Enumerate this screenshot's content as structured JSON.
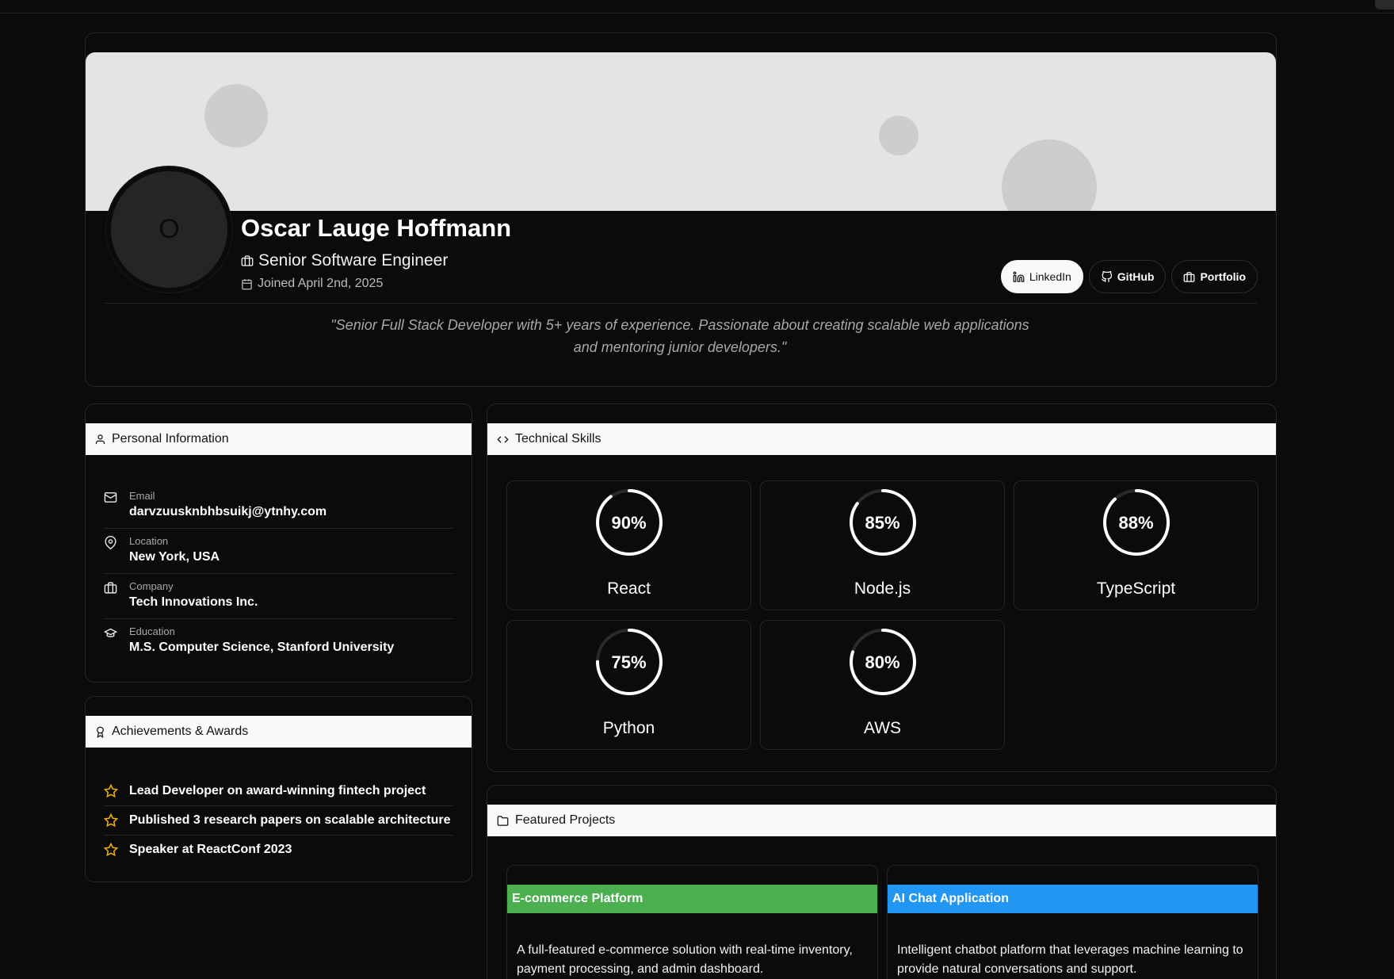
{
  "profile": {
    "avatar_initial": "O",
    "name": "Oscar Lauge Hoffmann",
    "role": "Senior Software Engineer",
    "joined": "Joined April 2nd, 2025",
    "bio": "\"Senior Full Stack Developer with 5+ years of experience. Passionate about creating scalable web applications and mentoring junior developers.\"",
    "socials": [
      {
        "label": "LinkedIn",
        "icon": "linkedin-icon"
      },
      {
        "label": "GitHub",
        "icon": "github-icon"
      },
      {
        "label": "Portfolio",
        "icon": "briefcase-icon"
      }
    ]
  },
  "personal": {
    "title": "Personal Information",
    "rows": [
      {
        "label": "Email",
        "value": "darvzuusknbhbsuikj@ytnhy.com",
        "icon": "mail-icon"
      },
      {
        "label": "Location",
        "value": "New York, USA",
        "icon": "map-pin-icon"
      },
      {
        "label": "Company",
        "value": "Tech Innovations Inc.",
        "icon": "briefcase-icon"
      },
      {
        "label": "Education",
        "value": "M.S. Computer Science, Stanford University",
        "icon": "graduation-cap-icon"
      }
    ]
  },
  "achievements": {
    "title": "Achievements & Awards",
    "items": [
      "Lead Developer on award-winning fintech project",
      "Published 3 research papers on scalable architecture",
      "Speaker at ReactConf 2023"
    ]
  },
  "skills": {
    "title": "Technical Skills",
    "items": [
      {
        "name": "React",
        "percent": 90,
        "label": "90%"
      },
      {
        "name": "Node.js",
        "percent": 85,
        "label": "85%"
      },
      {
        "name": "TypeScript",
        "percent": 88,
        "label": "88%"
      },
      {
        "name": "Python",
        "percent": 75,
        "label": "75%"
      },
      {
        "name": "AWS",
        "percent": 80,
        "label": "80%"
      }
    ]
  },
  "projects": {
    "title": "Featured Projects",
    "items": [
      {
        "title": "E-commerce Platform",
        "color": "#4caf50",
        "description": "A full-featured e-commerce solution with real-time inventory, payment processing, and admin dashboard."
      },
      {
        "title": "AI Chat Application",
        "color": "#2196f3",
        "description": "Intelligent chatbot platform that leverages machine learning to provide natural conversations and support."
      }
    ]
  },
  "colors": {
    "banner": "#e4e4e4",
    "accent_star": "#f5b400",
    "background": "#0b0b0b"
  }
}
